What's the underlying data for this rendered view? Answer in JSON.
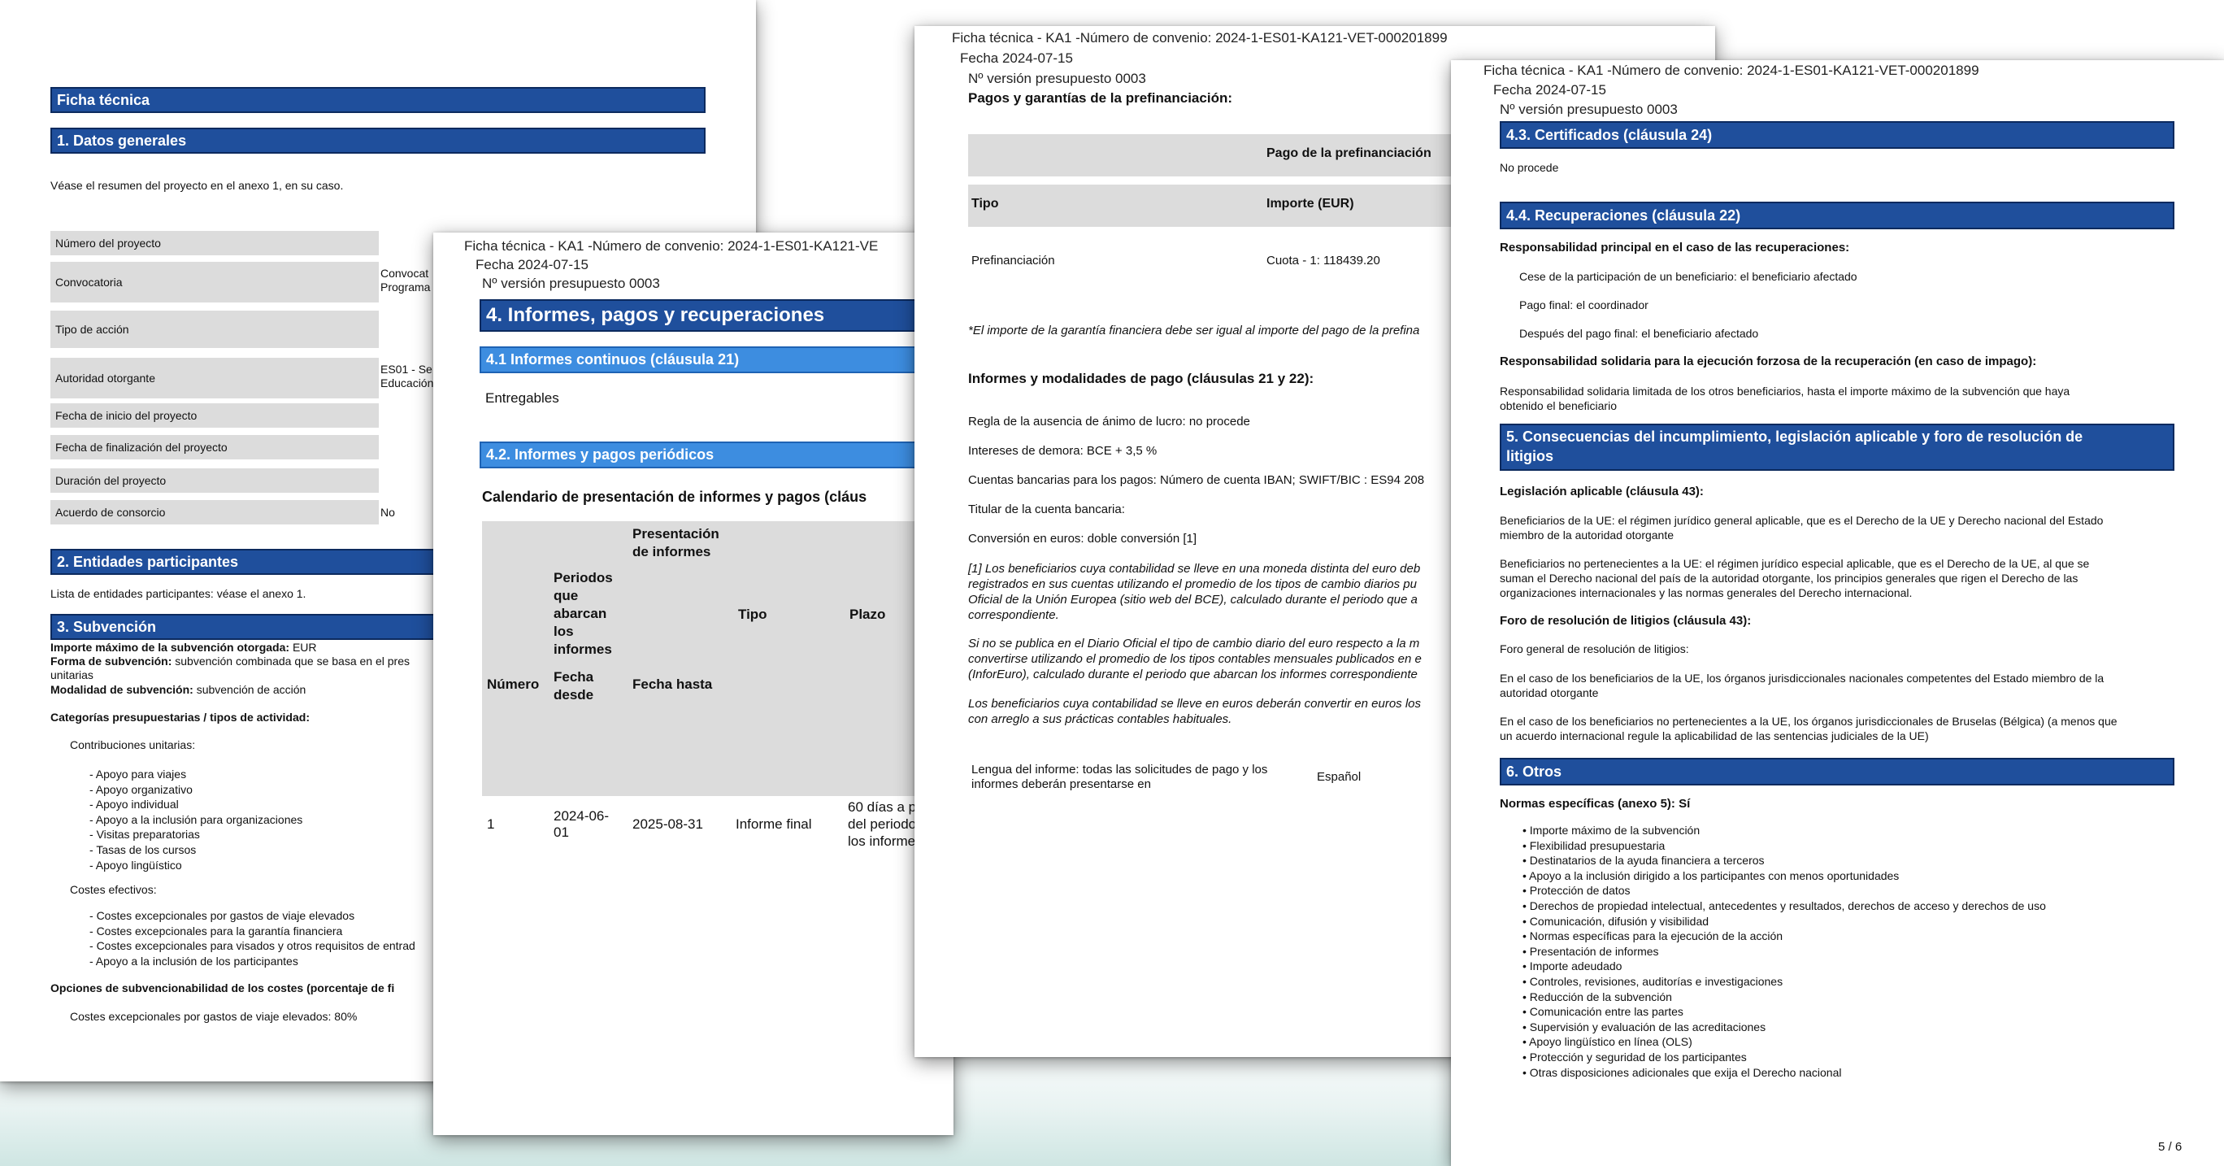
{
  "p1": {
    "title": "Ficha técnica",
    "s1": "1. Datos generales",
    "intro": "Véase el resumen del proyecto en el anexo 1, en su caso.",
    "rows": [
      {
        "label": "Número del proyecto",
        "value": ""
      },
      {
        "label": "Convocatoria",
        "value": "Convocat\nPrograma"
      },
      {
        "label": "Tipo de acción",
        "value": ""
      },
      {
        "label": "Autoridad otorgante",
        "value": "ES01 - Se\nEducación"
      },
      {
        "label": "Fecha de inicio del proyecto",
        "value": ""
      },
      {
        "label": "Fecha de finalización del proyecto",
        "value": ""
      },
      {
        "label": "Duración del proyecto",
        "value": ""
      },
      {
        "label": "Acuerdo de consorcio",
        "value": "No"
      }
    ],
    "s2": "2. Entidades participantes",
    "s2_text": "Lista de entidades participantes: véase el anexo 1.",
    "s3": "3. Subvención",
    "importe_label": "Importe máximo de la subvención otorgada:",
    "importe_value": "EUR",
    "forma_label": "Forma de subvención:",
    "forma_value": "subvención combinada que se basa en el pres",
    "forma_cont": "unitarias",
    "modalidad_label": "Modalidad de subvención:",
    "modalidad_value": "subvención de acción",
    "categorias": "Categorías presupuestarias / tipos de actividad:",
    "contrib": "Contribuciones unitarias:",
    "contrib_items": [
      "Apoyo para viajes",
      "Apoyo organizativo",
      "Apoyo individual",
      "Apoyo a la inclusión para organizaciones",
      "Visitas preparatorias",
      "Tasas de los cursos",
      "Apoyo lingüístico"
    ],
    "costes": "Costes efectivos:",
    "costes_items": [
      "Costes excepcionales por gastos de viaje elevados",
      "Costes excepcionales para la garantía financiera",
      "Costes excepcionales para visados y otros requisitos de entrad",
      "Apoyo a la inclusión de los participantes"
    ],
    "opciones": "Opciones de subvencionabilidad de los costes (porcentaje de fi",
    "costes_pct": "Costes excepcionales por gastos de viaje elevados: 80%"
  },
  "p2": {
    "hdr1": "Ficha técnica - KA1 -Número de convenio: 2024-1-ES01-KA121-VE",
    "hdr2": "Fecha  2024-07-15",
    "hdr3": "Nº versión presupuesto 0003",
    "s4": "4. Informes, pagos y recuperaciones",
    "s41": "4.1 Informes continuos (cláusula 21)",
    "entregables": "Entregables",
    "s42": "4.2. Informes y pagos periódicos",
    "cal_title": "Calendario de presentación de informes y pagos (cláus",
    "th_numero": "Número",
    "th_periodos": "Periodos\nque\nabarcan\nlos\ninformes",
    "th_presentacion": "Presentación\nde informes",
    "th_fecha_desde": "Fecha\ndesde",
    "th_fecha_hasta": "Fecha hasta",
    "th_tipo": "Tipo",
    "th_plazo": "Plazo",
    "row": {
      "numero": "1",
      "desde": "2024-06-\n01",
      "hasta": "2025-08-31",
      "tipo": "Informe final",
      "plazo": "60 días a p\ndel periodo\nlos informe"
    }
  },
  "p3": {
    "hdr1": "Ficha técnica - KA1 -Número de convenio: 2024-1-ES01-KA121-VET-000201899",
    "hdr2": "Fecha  2024-07-15",
    "hdr3": "Nº versión presupuesto 0003",
    "title": "Pagos y garantías de la prefinanciación:",
    "th_pago": "Pago de la prefinanciación",
    "th_tipo": "Tipo",
    "th_importe": "Importe (EUR)",
    "row_tipo": "Prefinanciación",
    "row_importe": "Cuota - 1: 118439.20",
    "note": "*El importe de la garantía financiera debe ser igual al importe del pago de la prefina",
    "informes_title": "Informes y modalidades de pago (cláusulas 21 y 22):",
    "regla": "Regla de la ausencia de ánimo de lucro: no procede",
    "intereses": "Intereses de demora: BCE + 3,5 %",
    "cuentas": "Cuentas bancarias para los pagos: Número de cuenta IBAN; SWIFT/BIC : ES94 208",
    "titular": "Titular de la cuenta bancaria:",
    "conversion": "Conversión en euros: doble conversión  [1]",
    "fn1": "[1] Los beneficiarios cuya contabilidad se lleve en una moneda distinta del euro deb\nregistrados en sus cuentas utilizando el promedio de los tipos de cambio diarios pu\nOficial de la Unión Europea (sitio web del BCE), calculado durante el periodo que a\ncorrespondiente.",
    "fn2": "Si no se publica en el Diario Oficial el tipo de cambio diario del euro respecto a la m\nconvertirse utilizando el promedio de los tipos contables mensuales publicados en e\n(InforEuro), calculado durante el periodo que abarcan los informes correspondiente",
    "fn3": "Los beneficiarios cuya contabilidad se lleve en euros deberán convertir en euros los\ncon arreglo a sus prácticas contables habituales.",
    "lengua_label": "Lengua del informe: todas las solicitudes de pago y los\ninformes deberán presentarse en",
    "lengua_value": "Español"
  },
  "p4": {
    "hdr1": "Ficha técnica - KA1 -Número de convenio: 2024-1-ES01-KA121-VET-000201899",
    "hdr2": "Fecha  2024-07-15",
    "hdr3": "Nº versión presupuesto 0003",
    "s43": "4.3. Certificados (cláusula 24)",
    "no_procede": "No procede",
    "s44": "4.4. Recuperaciones (cláusula 22)",
    "resp_principal": "Responsabilidad principal en el caso de las recuperaciones:",
    "cese": "Cese de la participación de un beneficiario: el beneficiario afectado",
    "pago_final": "Pago final: el coordinador",
    "despues": "Después del pago final: el beneficiario afectado",
    "resp_solidaria": "Responsabilidad solidaria para la ejecución forzosa de la recuperación (en caso de impago):",
    "resp_solidaria_text": "Responsabilidad solidaria limitada de los otros beneficiarios, hasta el importe máximo de la subvención que haya\nobtenido el beneficiario",
    "s5": "5. Consecuencias del incumplimiento, legislación aplicable y foro de resolución de\nlitigios",
    "legislacion": "Legislación aplicable (cláusula 43):",
    "leg_ue": "Beneficiarios de la UE: el régimen jurídico general aplicable, que es el Derecho de la UE y Derecho nacional del Estado\nmiembro de la autoridad otorgante",
    "leg_no_ue": "Beneficiarios no pertenecientes a la UE: el régimen jurídico especial aplicable, que es el Derecho de la UE, al que se\nsuman el Derecho nacional del país de la autoridad otorgante, los principios generales que rigen el Derecho de las\norganizaciones internacionales y las normas generales del Derecho internacional.",
    "foro": "Foro de resolución de litigios (cláusula 43):",
    "foro_general": "Foro general de resolución de litigios:",
    "foro_ue": "En el caso de los beneficiarios de la UE, los órganos jurisdiccionales nacionales competentes del Estado miembro de la\nautoridad otorgante",
    "foro_no_ue": "En el caso de los beneficiarios no pertenecientes a la UE, los órganos jurisdiccionales de Bruselas (Bélgica) (a menos que\nun acuerdo internacional regule la aplicabilidad de las sentencias judiciales de la UE)",
    "s6": "6. Otros",
    "normas": "Normas específicas (anexo 5): Sí",
    "normas_items": [
      "Importe máximo de la subvención",
      "Flexibilidad presupuestaria",
      "Destinatarios de la ayuda financiera a terceros",
      "Apoyo a la inclusión dirigido a los participantes con menos oportunidades",
      "Protección de datos",
      "Derechos de propiedad intelectual, antecedentes y resultados, derechos de acceso y derechos de uso",
      "Comunicación, difusión y visibilidad",
      "Normas específicas para la ejecución de la acción",
      "Presentación de informes",
      "Importe adeudado",
      "Controles, revisiones, auditorías e investigaciones",
      "Reducción de la subvención",
      "Comunicación entre las partes",
      "Supervisión y evaluación de las acreditaciones",
      "Apoyo lingüístico en línea (OLS)",
      "Protección y seguridad de los participantes",
      "Otras disposiciones adicionales que exija el Derecho nacional"
    ],
    "page_num": "5 / 6"
  }
}
